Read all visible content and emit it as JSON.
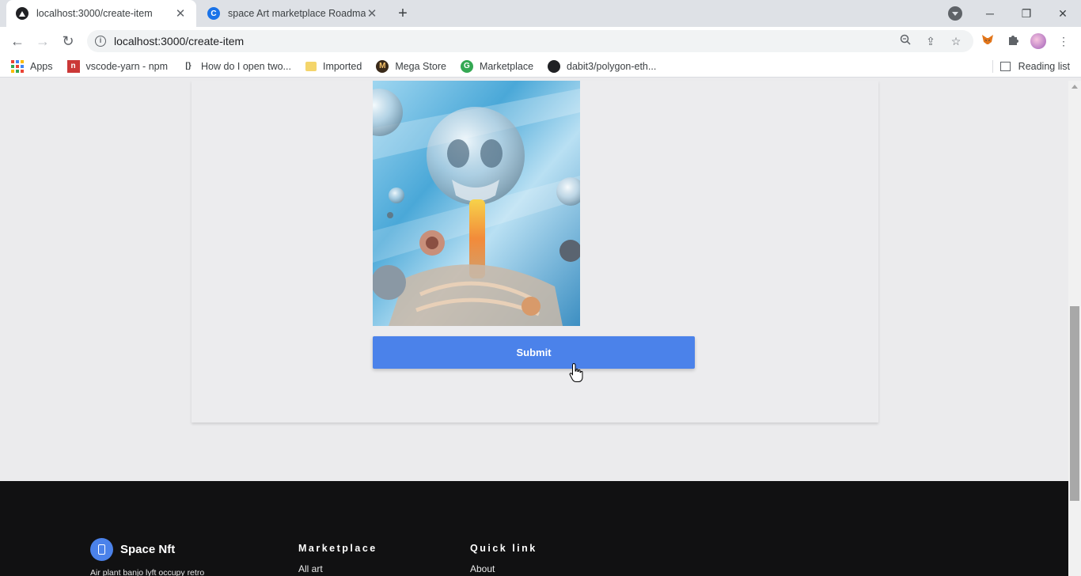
{
  "browser": {
    "tabs": [
      {
        "title": "localhost:3000/create-item",
        "icon": "app-icon",
        "active": true
      },
      {
        "title": "space Art marketplace Roadmap",
        "icon": "canva-icon",
        "active": false
      }
    ],
    "url": "localhost:3000/create-item",
    "bookmarks": [
      {
        "label": "Apps",
        "icon": "apps-grid-icon"
      },
      {
        "label": "vscode-yarn - npm",
        "icon": "npm-icon"
      },
      {
        "label": "How do I open two...",
        "icon": "stackoverflow-icon"
      },
      {
        "label": "Imported",
        "icon": "folder-icon"
      },
      {
        "label": "Mega Store",
        "icon": "mega-store-icon"
      },
      {
        "label": "Marketplace",
        "icon": "marketplace-icon"
      },
      {
        "label": "dabit3/polygon-eth...",
        "icon": "github-icon"
      }
    ],
    "reading_list": "Reading list"
  },
  "form": {
    "submit_label": "Submit"
  },
  "footer": {
    "brand": "Space Nft",
    "description": "Air plant banjo lyft occupy retro",
    "columns": [
      {
        "heading": "Marketplace",
        "link": "All art"
      },
      {
        "heading": "Quick link",
        "link": "About"
      }
    ]
  },
  "colors": {
    "accent": "#4b82ea",
    "footer_bg": "#111112",
    "page_bg": "#ebebed"
  }
}
